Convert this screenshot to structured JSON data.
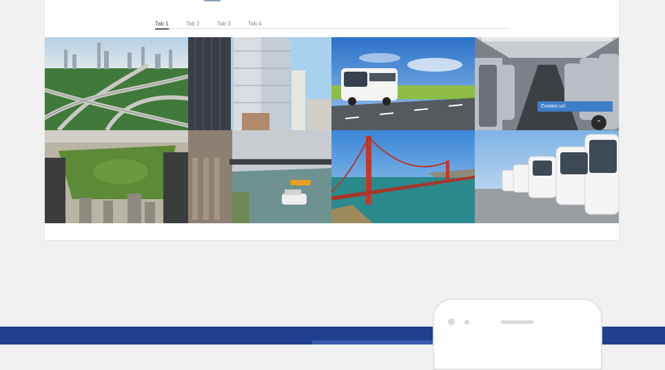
{
  "tabs": [
    {
      "label": "Tab 1",
      "active": true
    },
    {
      "label": "Tab 2",
      "active": false
    },
    {
      "label": "Tab 3",
      "active": false
    },
    {
      "label": "Tab 4",
      "active": false
    }
  ],
  "gallery": [
    {
      "name": "highway-interchange-image"
    },
    {
      "name": "skyscrapers-image"
    },
    {
      "name": "coach-bus-on-road-image"
    },
    {
      "name": "bus-interior-seats-image"
    },
    {
      "name": "central-park-aerial-image"
    },
    {
      "name": "chicago-river-boats-image"
    },
    {
      "name": "golden-gate-bridge-image"
    },
    {
      "name": "bus-fleet-image"
    }
  ],
  "contact": {
    "label": "Contact us!"
  },
  "colors": {
    "accent": "#3d7ec9",
    "band": "#213f8f"
  }
}
